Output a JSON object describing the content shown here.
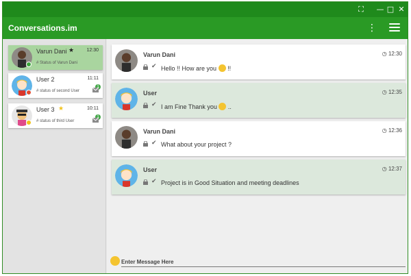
{
  "app": {
    "title": "Conversations.im"
  },
  "window_controls": {
    "fullscreen": "⛶",
    "minimize": "—",
    "maximize": "□",
    "close": "✕"
  },
  "contacts": [
    {
      "name": "Varun Dani",
      "time": "12:30",
      "status": "# Status of Varun Dani",
      "starred": true,
      "star_color": "#222222",
      "status_color": "#3aa63a",
      "active": true
    },
    {
      "name": "User 2",
      "time": "11:11",
      "status": "# status of second User",
      "starred": false,
      "status_color": "#e64a2e",
      "unread": "1"
    },
    {
      "name": "User 3",
      "time": "10:11",
      "status": "# status of third User",
      "starred": true,
      "star_color": "#f2c21a",
      "status_color": "#f2c21a",
      "unread": "1"
    }
  ],
  "messages": [
    {
      "sender": "Varun Dani",
      "time": "12:30",
      "text": "Hello !! How are you",
      "suffix": " !!",
      "kind": "sent"
    },
    {
      "sender": "User",
      "time": "12:35",
      "text": "I am Fine Thank you",
      "suffix": " ..",
      "kind": "recv"
    },
    {
      "sender": "Varun Dani",
      "time": "12:36",
      "text": "What about your project ?",
      "suffix": "",
      "kind": "sent"
    },
    {
      "sender": "User",
      "time": "12:37",
      "text": "Project is in Good Situation and meeting deadlines",
      "suffix": "",
      "kind": "recv"
    }
  ],
  "composer": {
    "placeholder": "Enter Message Here"
  },
  "colors": {
    "titlebar": "#1f8a1c",
    "appbar": "#2a9a25",
    "active_contact": "#a9d59f",
    "received_bubble": "#dce8dc",
    "badge": "#45a84a"
  }
}
